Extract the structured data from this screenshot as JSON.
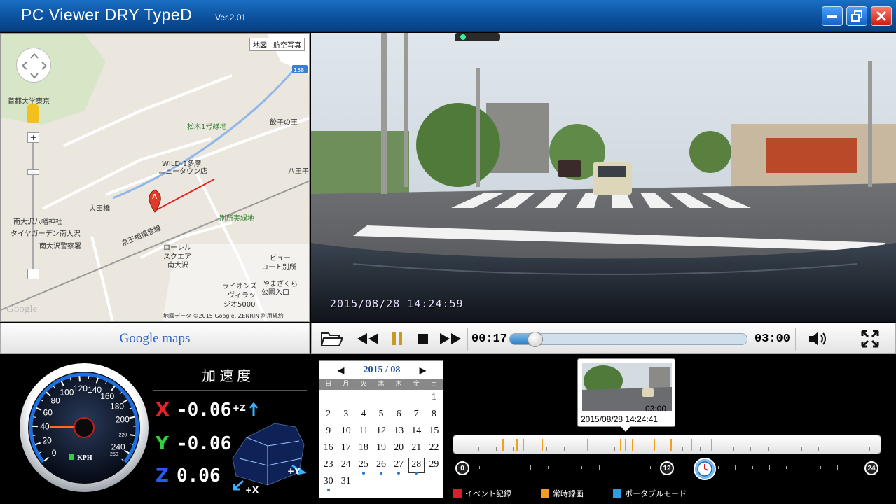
{
  "window": {
    "title": "PC Viewer DRY TypeD",
    "version": "Ver.2.01"
  },
  "map": {
    "type_buttons": [
      "地図",
      "航空写真"
    ],
    "labels": [
      {
        "text": "首都大学東京",
        "color": "dark"
      },
      {
        "text": "松木1号緑地",
        "color": "green"
      },
      {
        "text": "餃子の王",
        "color": "dark"
      },
      {
        "text": "WILD-1多摩",
        "color": "dark"
      },
      {
        "text": "ニュータウン店",
        "color": "dark"
      },
      {
        "text": "八王子",
        "color": "dark"
      },
      {
        "text": "大田橋",
        "color": "dark"
      },
      {
        "text": "京王相模原線",
        "color": "dark"
      },
      {
        "text": "南大沢八幡神社",
        "color": "dark"
      },
      {
        "text": "タイヤガーデン南大沢",
        "color": "dark"
      },
      {
        "text": "南大沢警察署",
        "color": "dark"
      },
      {
        "text": "別所実緑地",
        "color": "green"
      },
      {
        "text": "ローレル",
        "color": "dark"
      },
      {
        "text": "スクエア",
        "color": "dark"
      },
      {
        "text": "南大沢",
        "color": "dark"
      },
      {
        "text": "ビュー",
        "color": "dark"
      },
      {
        "text": "コート別所",
        "color": "dark"
      },
      {
        "text": "ライオンズ",
        "color": "dark"
      },
      {
        "text": "ヴィラッ",
        "color": "dark"
      },
      {
        "text": "ジオ5000",
        "color": "dark"
      },
      {
        "text": "やまざくら",
        "color": "dark"
      },
      {
        "text": "公園入口",
        "color": "dark"
      },
      {
        "text": "158",
        "color": "dark"
      }
    ],
    "marker_label": "A",
    "google_logo": "Google",
    "footer": "地図データ ©2015 Google, ZENRIN 利用規約",
    "zoom_in": "+",
    "zoom_out": "−"
  },
  "gmaps_bar": {
    "label": "Google maps"
  },
  "video": {
    "timestamp": "2015/08/28  14:24:59"
  },
  "player": {
    "time_current": "00:17",
    "time_total": "03:00",
    "progress": 0.094
  },
  "speedometer": {
    "unit": "KPH",
    "major_ticks": [
      "0",
      "20",
      "40",
      "60",
      "80",
      "100",
      "120",
      "140",
      "160",
      "180",
      "200",
      "220",
      "240",
      "250"
    ],
    "speed": 40
  },
  "accel": {
    "title": "加速度",
    "rows": [
      {
        "axis": "X",
        "value": "-0.06",
        "color": "#e8202a"
      },
      {
        "axis": "Y",
        "value": "-0.06",
        "color": "#2ed040"
      },
      {
        "axis": "Z",
        "value": "0.06",
        "color": "#2a5ae8"
      }
    ],
    "car_axis_labels": [
      "+Z",
      "+Y",
      "+X"
    ]
  },
  "calendar": {
    "title": "2015 / 08",
    "prev": "◀",
    "next": "▶",
    "weekdays": [
      "日",
      "月",
      "火",
      "水",
      "木",
      "金",
      "土"
    ],
    "weeks": [
      [
        "",
        "",
        "",
        "",
        "",
        "",
        "1"
      ],
      [
        "2",
        "3",
        "4",
        "5",
        "6",
        "7",
        "8"
      ],
      [
        "9",
        "10",
        "11",
        "12",
        "13",
        "14",
        "15"
      ],
      [
        "16",
        "17",
        "18",
        "19",
        "20",
        "21",
        "22"
      ],
      [
        "23",
        "24",
        "25",
        "26",
        "27",
        "28",
        "29"
      ],
      [
        "30",
        "31",
        "",
        "",
        "",
        "",
        ""
      ]
    ],
    "dotted_days": [
      "25",
      "26",
      "27",
      "28",
      "30"
    ],
    "selected_day": "28"
  },
  "thumbnail": {
    "duration": "03:00",
    "datetime": "2015/08/28 14:24:41"
  },
  "timeline": {
    "scale_labels": [
      "0",
      "12",
      "24"
    ],
    "event_hours": [
      2.4,
      3.2,
      3.6,
      4.7,
      7.4,
      9.3,
      9.6,
      10.0,
      11.3,
      12.3,
      13.5,
      14.7
    ],
    "current_hour": 14.2,
    "legend": [
      {
        "label": "イベント記録",
        "color": "#d8202a"
      },
      {
        "label": "常時録画",
        "color": "#f0a020"
      },
      {
        "label": "ポータブルモード",
        "color": "#2aa0e0"
      }
    ]
  }
}
